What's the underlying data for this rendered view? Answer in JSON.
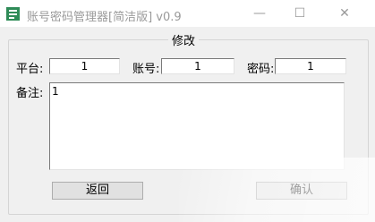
{
  "window": {
    "title": "账号密码管理器[简洁版] v0.9",
    "icon": "app-logo-icon",
    "controls": {
      "minimize": "—",
      "maximize": "☐",
      "close": "✕"
    }
  },
  "form": {
    "group_title": "修改",
    "platform": {
      "label": "平台:",
      "value": "1"
    },
    "account": {
      "label": "账号:",
      "value": "1"
    },
    "password": {
      "label": "密码:",
      "value": "1"
    },
    "notes": {
      "label": "备注:",
      "value": "1"
    }
  },
  "buttons": {
    "back": "返回",
    "confirm": "确认"
  },
  "colors": {
    "app_icon": "#2e8b57",
    "title_text": "#9a9a9a",
    "window_bg": "#f0f0f0"
  }
}
